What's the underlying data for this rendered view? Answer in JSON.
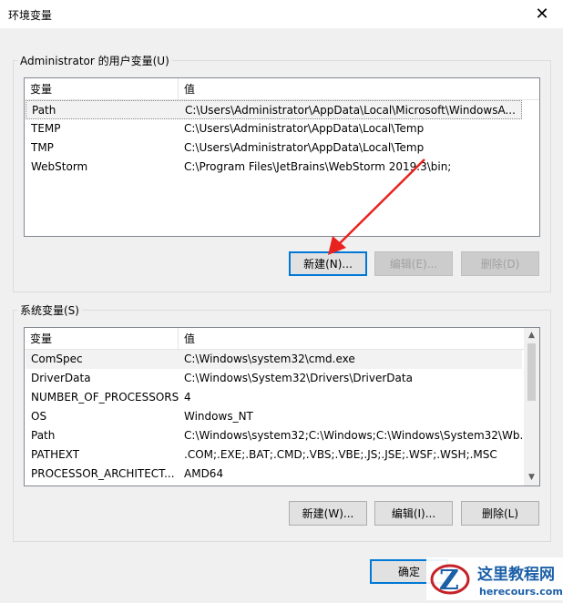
{
  "window": {
    "title": "环境变量",
    "close_icon": "close-icon"
  },
  "user_vars": {
    "group_label": "Administrator 的用户变量(U)",
    "columns": [
      "变量",
      "值"
    ],
    "rows": [
      {
        "name": "Path",
        "value": "C:\\Users\\Administrator\\AppData\\Local\\Microsoft\\WindowsA..."
      },
      {
        "name": "TEMP",
        "value": "C:\\Users\\Administrator\\AppData\\Local\\Temp"
      },
      {
        "name": "TMP",
        "value": "C:\\Users\\Administrator\\AppData\\Local\\Temp"
      },
      {
        "name": "WebStorm",
        "value": "C:\\Program Files\\JetBrains\\WebStorm 2019.3\\bin;"
      }
    ],
    "buttons": {
      "new": "新建(N)...",
      "edit": "编辑(E)...",
      "delete": "删除(D)"
    }
  },
  "system_vars": {
    "group_label": "系统变量(S)",
    "columns": [
      "变量",
      "值"
    ],
    "rows": [
      {
        "name": "ComSpec",
        "value": "C:\\Windows\\system32\\cmd.exe"
      },
      {
        "name": "DriverData",
        "value": "C:\\Windows\\System32\\Drivers\\DriverData"
      },
      {
        "name": "NUMBER_OF_PROCESSORS",
        "value": "4"
      },
      {
        "name": "OS",
        "value": "Windows_NT"
      },
      {
        "name": "Path",
        "value": "C:\\Windows\\system32;C:\\Windows;C:\\Windows\\System32\\Wb..."
      },
      {
        "name": "PATHEXT",
        "value": ".COM;.EXE;.BAT;.CMD;.VBS;.VBE;.JS;.JSE;.WSF;.WSH;.MSC"
      },
      {
        "name": "PROCESSOR_ARCHITECT...",
        "value": "AMD64"
      }
    ],
    "buttons": {
      "new": "新建(W)...",
      "edit": "编辑(I)...",
      "delete": "删除(L)"
    }
  },
  "footer": {
    "ok": "确定"
  },
  "watermark": {
    "name": "这里教程网",
    "url": "herecours.com"
  },
  "colors": {
    "accent": "#0078d7",
    "arrow": "#e8231f"
  }
}
